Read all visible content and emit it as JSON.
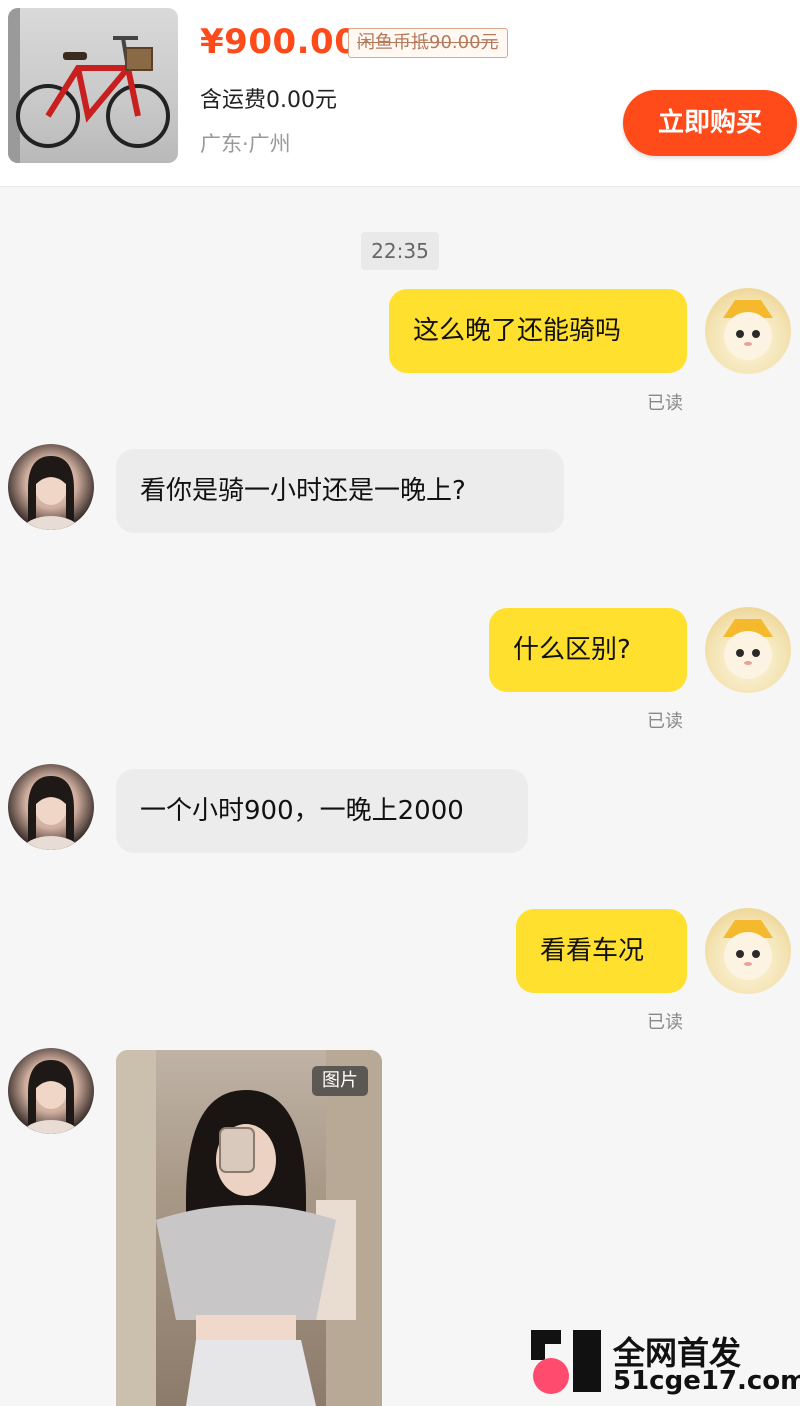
{
  "product": {
    "price": "¥900.00",
    "original_price_tag": "闲鱼币抵90.00元",
    "shipping": "含运费0.00元",
    "location": "广东·广州",
    "buy_label": "立即购买"
  },
  "chat": {
    "timestamp": "22:35",
    "messages": [
      {
        "from": "me",
        "text": "这么晚了还能骑吗",
        "status": "已读"
      },
      {
        "from": "other",
        "text": "看你是骑一小时还是一晚上?"
      },
      {
        "from": "me",
        "text": "什么区别?",
        "status": "已读"
      },
      {
        "from": "other",
        "text": "一个小时900，一晚上2000"
      },
      {
        "from": "me",
        "text": "看看车况",
        "status": "已读"
      },
      {
        "from": "other",
        "type": "image",
        "badge": "图片"
      }
    ]
  },
  "watermark": {
    "line1": "全网首发",
    "line2": "51cge17.com",
    "logo_colors": [
      "#111111",
      "#ff4b6e"
    ]
  },
  "colors": {
    "accent": "#ff4a1a",
    "my_bubble": "#ffe02e",
    "other_bubble": "#ececec"
  }
}
